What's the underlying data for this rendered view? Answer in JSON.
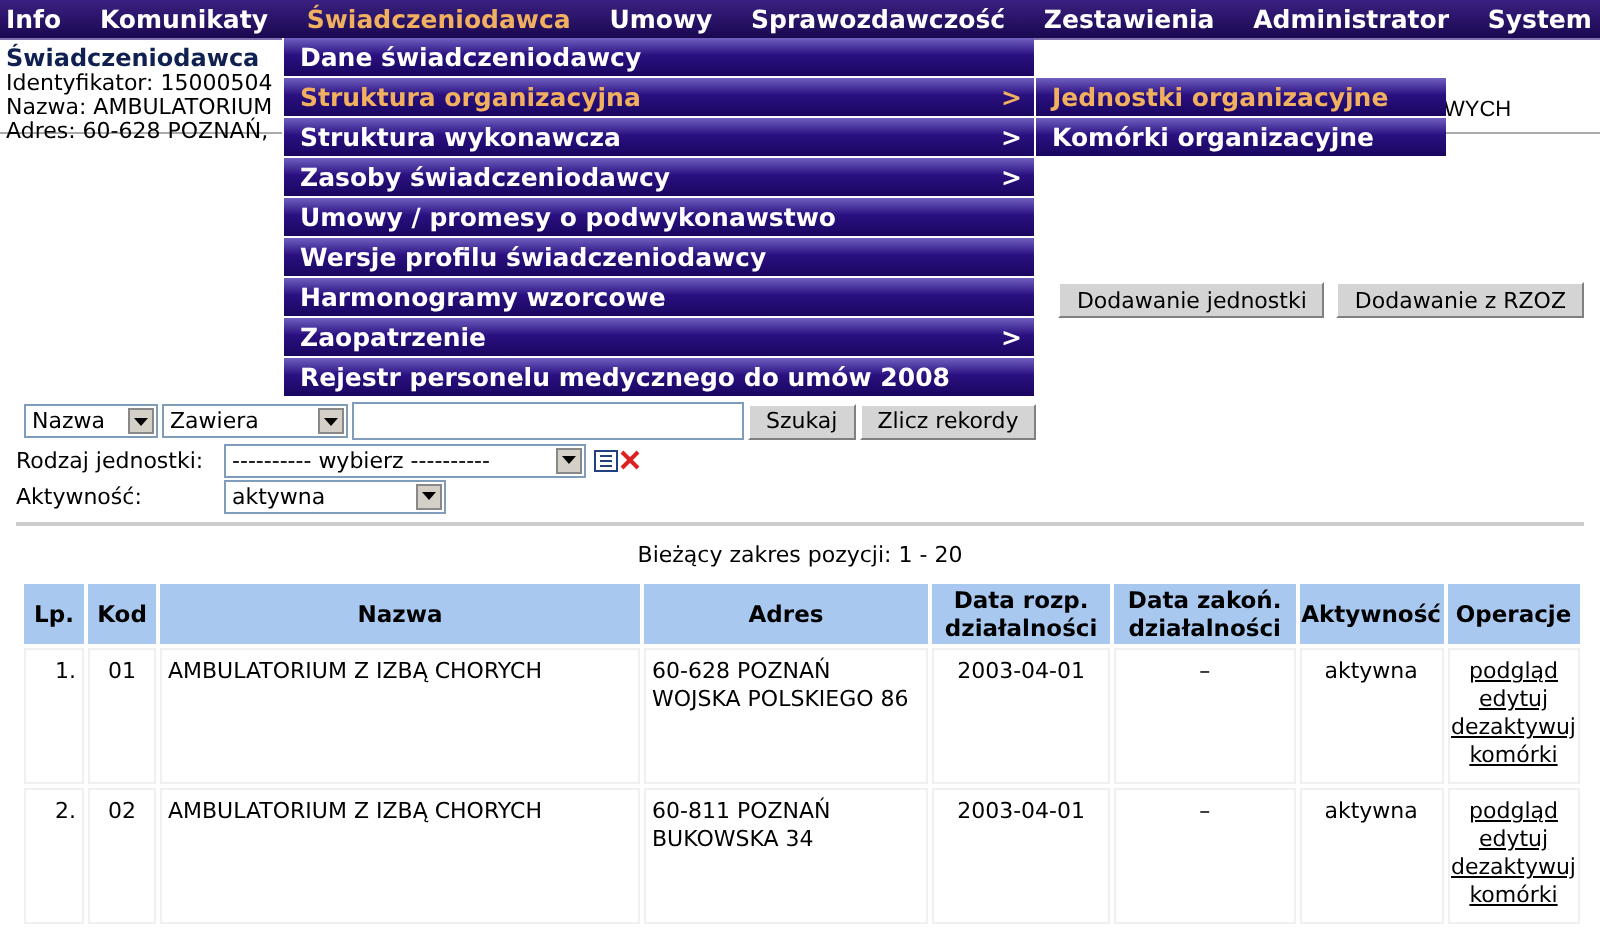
{
  "menu_bar": [
    {
      "label": "Info",
      "selected": false
    },
    {
      "label": "Komunikaty",
      "selected": false
    },
    {
      "label": "Świadczeniodawca",
      "selected": true
    },
    {
      "label": "Umowy",
      "selected": false
    },
    {
      "label": "Sprawozdawczość",
      "selected": false
    },
    {
      "label": "Zestawienia",
      "selected": false
    },
    {
      "label": "Administrator",
      "selected": false
    },
    {
      "label": "System",
      "selected": false
    }
  ],
  "dropdown": [
    {
      "label": "Dane świadczeniodawcy",
      "selected": false
    },
    {
      "label": "Struktura organizacyjna",
      "selected": true,
      "arrow": ">"
    },
    {
      "label": "Struktura wykonawcza",
      "selected": false,
      "arrow": ">"
    },
    {
      "label": "Zasoby świadczeniodawcy",
      "selected": false,
      "arrow": ">"
    },
    {
      "label": "Umowy / promesy o podwykonawstwo",
      "selected": false
    },
    {
      "label": "Wersje profilu świadczeniodawcy",
      "selected": false
    },
    {
      "label": "Harmonogramy wzorcowe",
      "selected": false
    },
    {
      "label": "Zaopatrzenie",
      "selected": false,
      "arrow": ">"
    },
    {
      "label": "Rejestr personelu medycznego do umów 2008",
      "selected": false
    }
  ],
  "submenu": [
    {
      "label": "Jednostki organizacyjne",
      "selected": true
    },
    {
      "label": "Komórki organizacyjne",
      "selected": false
    }
  ],
  "provider": {
    "title": "Świadczeniodawca",
    "lines": [
      "Identyfikator: 15000504",
      "Nazwa: AMBULATORIUM",
      "Adres: 60-628 POZNAŃ,"
    ],
    "name_tail": "WYCH"
  },
  "actions": [
    "Dodawanie jednostki",
    "Dodawanie z RZOZ"
  ],
  "search": {
    "field": "Nazwa",
    "mode": "Zawiera",
    "buttons": [
      "Szukaj",
      "Zlicz rekordy"
    ]
  },
  "filters": [
    {
      "label": "Rodzaj jednostki:",
      "value": "---------- wybierz ----------",
      "kind": "type"
    },
    {
      "label": "Aktywność:",
      "value": "aktywna",
      "kind": "plain"
    }
  ],
  "range": "Bieżący zakres pozycji: 1 - 20",
  "table": {
    "columns": [
      "Lp.",
      "Kod",
      "Nazwa",
      "Adres",
      "Data rozp. działalności",
      "Data zakoń. działalności",
      "Aktywność",
      "Operacje"
    ],
    "rows": [
      {
        "lp": "1.",
        "kod": "01",
        "nazwa": "AMBULATORIUM Z IZBĄ CHORYCH",
        "adres": [
          "60-628 POZNAŃ",
          "WOJSKA POLSKIEGO 86"
        ],
        "start": "2003-04-01",
        "end": "–",
        "status": "aktywna",
        "operations": [
          "podgląd",
          "edytuj",
          "dezaktywuj",
          "komórki"
        ]
      },
      {
        "lp": "2.",
        "kod": "02",
        "nazwa": "AMBULATORIUM Z IZBĄ CHORYCH",
        "adres": [
          "60-811 POZNAŃ",
          "BUKOWSKA 34"
        ],
        "start": "2003-04-01",
        "end": "–",
        "status": "aktywna",
        "operations": [
          "podgląd",
          "edytuj",
          "dezaktywuj",
          "komórki"
        ]
      }
    ]
  }
}
